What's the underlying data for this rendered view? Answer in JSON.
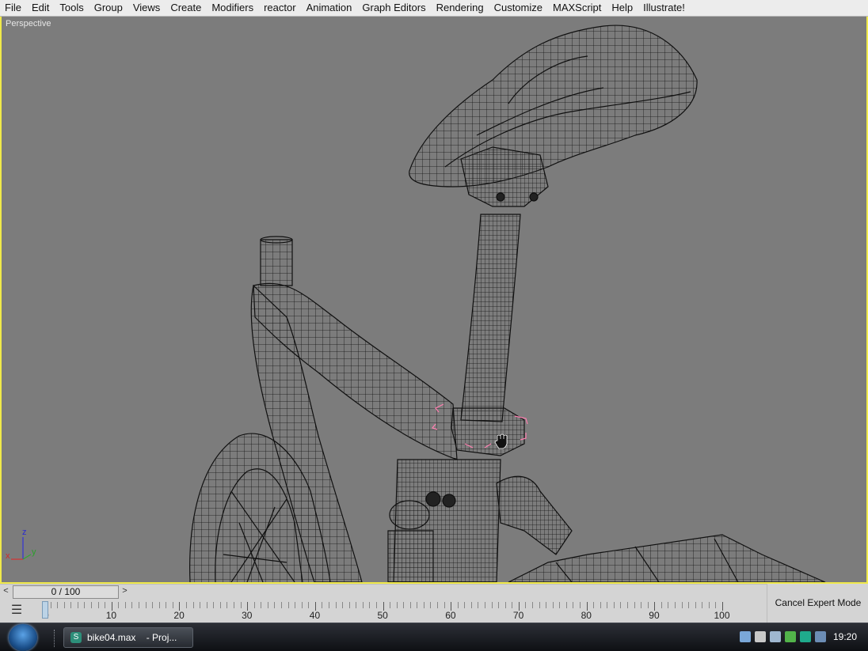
{
  "menubar": {
    "items": [
      "File",
      "Edit",
      "Tools",
      "Group",
      "Views",
      "Create",
      "Modifiers",
      "reactor",
      "Animation",
      "Graph Editors",
      "Rendering",
      "Customize",
      "MAXScript",
      "Help",
      "Illustrate!"
    ]
  },
  "viewport": {
    "label": "Perspective",
    "axis": {
      "x": "x",
      "y": "y",
      "z": "z"
    }
  },
  "timeslider": {
    "value": "0 / 100",
    "prev": "<",
    "next": ">"
  },
  "trackbar": {
    "labels": [
      "0",
      "10",
      "20",
      "30",
      "40",
      "50",
      "60",
      "70",
      "80",
      "90",
      "100"
    ]
  },
  "expert": {
    "cancel_label": "Cancel Expert Mode"
  },
  "taskbar": {
    "task_label": "bike04.max    - Proj...",
    "clock": "19:20"
  },
  "colors": {
    "viewport_bg": "#7c7c7c",
    "viewport_border": "#f0e94a",
    "wireframe": "#000000",
    "selection": "#ff7fb0"
  },
  "icons": [
    "start-orb-icon",
    "max-file-icon",
    "trackbar-toggle-icon",
    "speaker-icon",
    "network-icon",
    "hand-cursor-icon"
  ]
}
